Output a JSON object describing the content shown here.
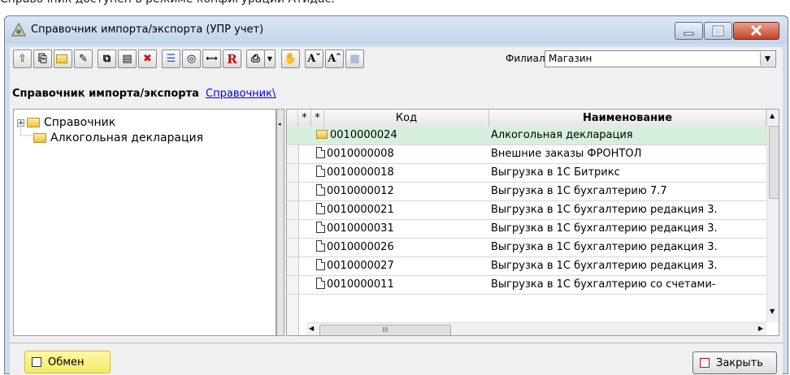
{
  "top_text": "Справочник доступен в режиме конфигурации Атидас.",
  "window": {
    "title": "Справочник импорта/экспорта (УПР учет)"
  },
  "toolbar": {
    "filial_label": "Филиал",
    "filial_value": "Магазин"
  },
  "breadcrumb": {
    "title": "Справочник импорта/экспорта",
    "link": "Справочник\\"
  },
  "tree": {
    "root_label": "Справочник",
    "child_label": "Алкогольная декларация"
  },
  "grid": {
    "columns": [
      "*",
      "*",
      "Код",
      "Наименование"
    ],
    "rows": [
      {
        "code": "0010000024",
        "name": "Алкогольная декларация",
        "kind": "folder"
      },
      {
        "code": "0010000008",
        "name": "Внешние заказы ФРОНТОЛ",
        "kind": "doc"
      },
      {
        "code": "0010000018",
        "name": "Выгрузка  в 1С Битрикс",
        "kind": "doc"
      },
      {
        "code": "0010000012",
        "name": "Выгрузка  в 1С бухгалтерию 7.7",
        "kind": "doc"
      },
      {
        "code": "0010000021",
        "name": "Выгрузка  в 1С бухгалтерию редакция 3.",
        "kind": "doc"
      },
      {
        "code": "0010000031",
        "name": "Выгрузка  в 1С бухгалтерию редакция 3.",
        "kind": "doc"
      },
      {
        "code": "0010000026",
        "name": "Выгрузка  в 1С бухгалтерию редакция 3.",
        "kind": "doc"
      },
      {
        "code": "0010000027",
        "name": "Выгрузка  в 1С бухгалтерию редакция 3.",
        "kind": "doc"
      },
      {
        "code": "0010000011",
        "name": "Выгрузка  в 1С бухгалтерию со счетами-",
        "kind": "doc"
      }
    ],
    "hscroll_label": "III"
  },
  "footer": {
    "exchange_label": "Обмен",
    "close_label": "Закрыть"
  },
  "colors": {
    "selected_row": "#d7f0dd",
    "highlight_button": "#f1ea6a",
    "link": "#0000ee"
  }
}
